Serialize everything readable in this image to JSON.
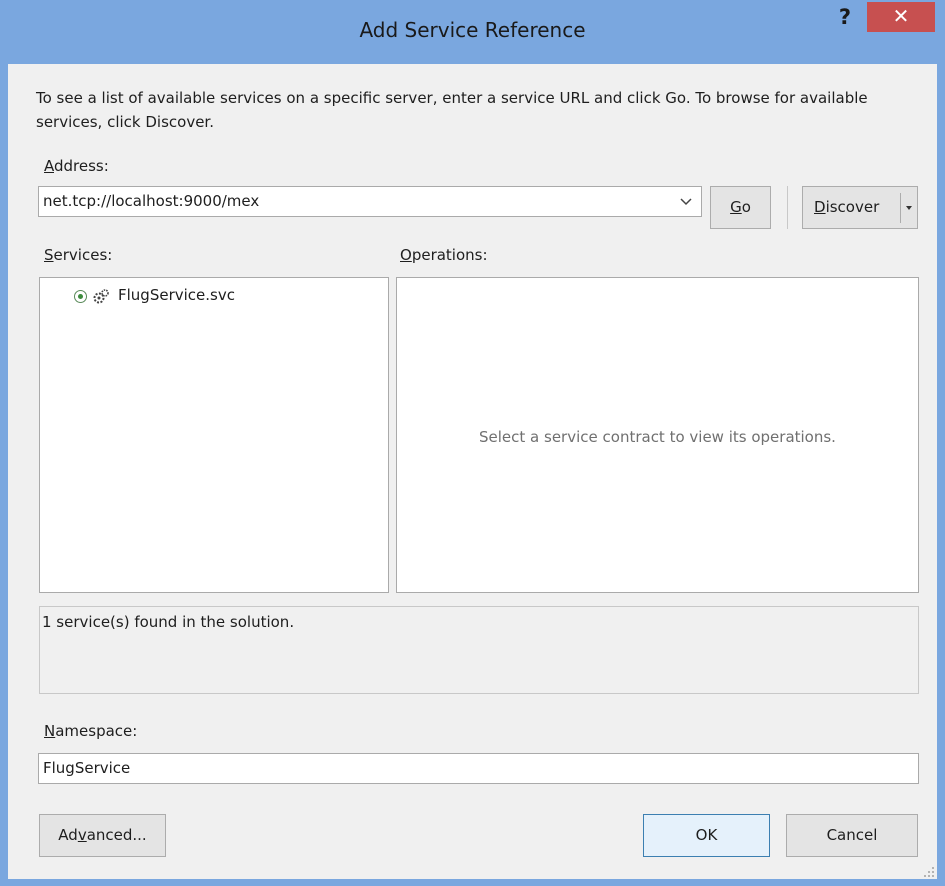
{
  "window": {
    "title": "Add Service Reference",
    "help_glyph": "?",
    "close_glyph": "✕"
  },
  "description": "To see a list of available services on a specific server, enter a service URL and click Go. To browse for available services, click Discover.",
  "address": {
    "label_key": "A",
    "label_rest": "ddress:",
    "value": "net.tcp://localhost:9000/mex"
  },
  "buttons": {
    "go_key": "G",
    "go_rest": "o",
    "discover_key": "D",
    "discover_rest": "iscover",
    "advanced_pre": "Ad",
    "advanced_key": "v",
    "advanced_post": "anced...",
    "ok": "OK",
    "cancel": "Cancel"
  },
  "services": {
    "label_key": "S",
    "label_rest": "ervices:",
    "items": [
      {
        "label": "FlugService.svc",
        "icon": "service-gear-icon"
      }
    ]
  },
  "operations": {
    "label_key": "O",
    "label_rest": "perations:",
    "placeholder": "Select a service contract to view its operations."
  },
  "status": {
    "message": "1 service(s) found in the solution."
  },
  "namespace": {
    "label_key": "N",
    "label_rest": "amespace:",
    "value": "FlugService"
  },
  "colors": {
    "title_bar": "#7aa7df",
    "close_button": "#c75050",
    "dialog_bg": "#f0f0f0"
  }
}
